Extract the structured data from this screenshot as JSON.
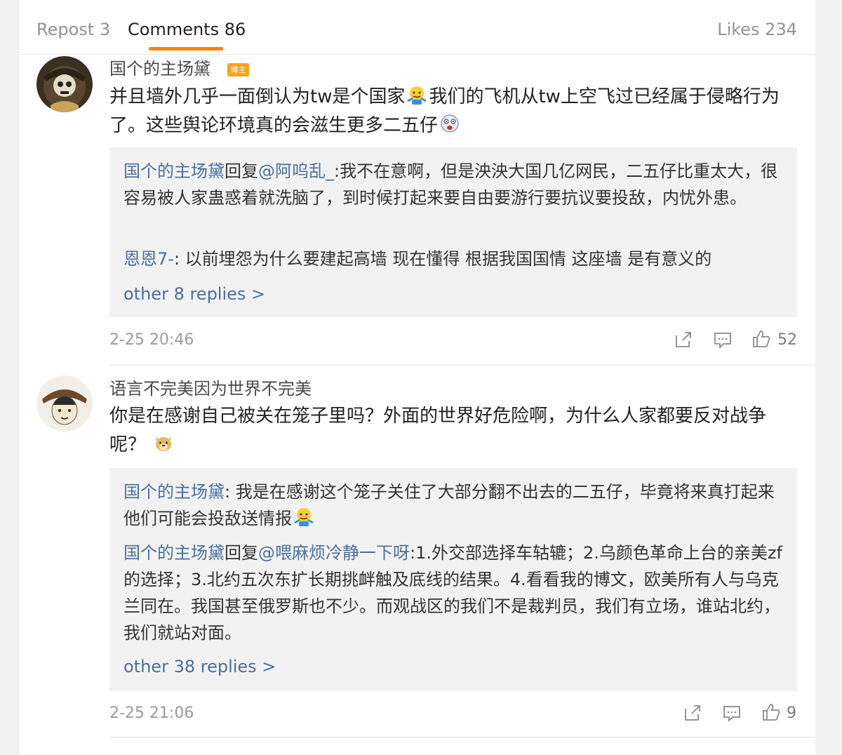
{
  "tabs": {
    "repost": "Repost 3",
    "comments": "Comments 86",
    "likes": "Likes 234"
  },
  "colors": {
    "accent": "#ff8200",
    "link": "#4a6f9d",
    "badge": "#f7a21c"
  },
  "comments": [
    {
      "username": "国个的主场黛",
      "badge": "博主",
      "text_a": "并且墙外几乎一面倒认为tw是个国家",
      "text_b": "我们的飞机从tw上空飞过已经属于侵略行为了。这些舆论环境真的会滋生更多二五仔",
      "replies": [
        {
          "name": "国个的主场黛",
          "reply_word": "回复",
          "mention": "@阿呜乱_",
          "text": ":我不在意啊，但是泱泱大国几亿网民，二五仔比重太大，很容易被人家蛊惑着就洗脑了，到时候打起来要自由要游行要抗议要投敌，内忧外患。"
        },
        {
          "name": "恩恩7-",
          "text": ": 以前埋怨为什么要建起高墙 现在懂得 根据我国国情 这座墙 是有意义的"
        }
      ],
      "more": "other 8 replies >",
      "time": "2-25 20:46",
      "likes": "52"
    },
    {
      "username": "语言不完美因为世界不完美",
      "text_a": "你是在感谢自己被关在笼子里吗？外面的世界好危险啊，为什么人家都要反对战争呢？",
      "replies": [
        {
          "name": "国个的主场黛",
          "text": ": 我是在感谢这个笼子关住了大部分翻不出去的二五仔，毕竟将来真打起来他们可能会投敌送情报"
        },
        {
          "name": "国个的主场黛",
          "reply_word": "回复",
          "mention": "@喂麻烦冷静一下呀",
          "text": ":1.外交部选择车轱辘；2.乌颜色革命上台的亲美zf的选择；3.北约五次东扩长期挑衅触及底线的结果。4.看看我的博文，欧美所有人与乌克兰同在。我国甚至俄罗斯也不少。而观战区的我们不是裁判员，我们有立场，谁站北约，我们就站对面。"
        }
      ],
      "more": "other 38 replies >",
      "time": "2-25 21:06",
      "likes": "9"
    }
  ],
  "icons": [
    "repost-icon",
    "comment-icon",
    "like-icon",
    "shrug-emoji",
    "scared-emoji",
    "doge-emoji"
  ]
}
